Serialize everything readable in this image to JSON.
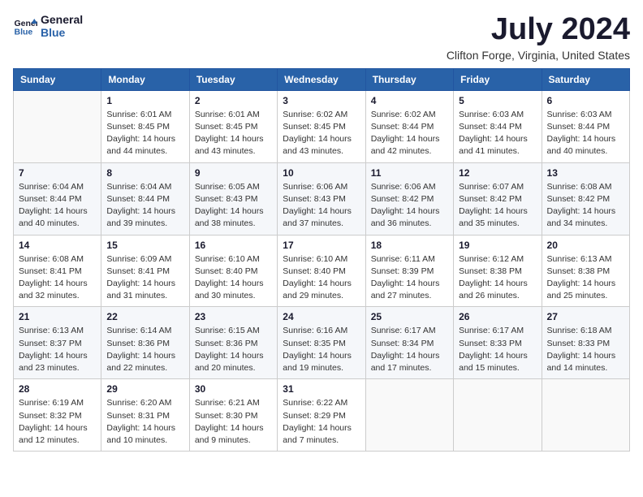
{
  "logo": {
    "text_general": "General",
    "text_blue": "Blue"
  },
  "title": "July 2024",
  "location": "Clifton Forge, Virginia, United States",
  "weekdays": [
    "Sunday",
    "Monday",
    "Tuesday",
    "Wednesday",
    "Thursday",
    "Friday",
    "Saturday"
  ],
  "weeks": [
    [
      {
        "day": "",
        "empty": true
      },
      {
        "day": "1",
        "sunrise": "6:01 AM",
        "sunset": "8:45 PM",
        "daylight": "14 hours and 44 minutes."
      },
      {
        "day": "2",
        "sunrise": "6:01 AM",
        "sunset": "8:45 PM",
        "daylight": "14 hours and 43 minutes."
      },
      {
        "day": "3",
        "sunrise": "6:02 AM",
        "sunset": "8:45 PM",
        "daylight": "14 hours and 43 minutes."
      },
      {
        "day": "4",
        "sunrise": "6:02 AM",
        "sunset": "8:44 PM",
        "daylight": "14 hours and 42 minutes."
      },
      {
        "day": "5",
        "sunrise": "6:03 AM",
        "sunset": "8:44 PM",
        "daylight": "14 hours and 41 minutes."
      },
      {
        "day": "6",
        "sunrise": "6:03 AM",
        "sunset": "8:44 PM",
        "daylight": "14 hours and 40 minutes."
      }
    ],
    [
      {
        "day": "7",
        "sunrise": "6:04 AM",
        "sunset": "8:44 PM",
        "daylight": "14 hours and 40 minutes."
      },
      {
        "day": "8",
        "sunrise": "6:04 AM",
        "sunset": "8:44 PM",
        "daylight": "14 hours and 39 minutes."
      },
      {
        "day": "9",
        "sunrise": "6:05 AM",
        "sunset": "8:43 PM",
        "daylight": "14 hours and 38 minutes."
      },
      {
        "day": "10",
        "sunrise": "6:06 AM",
        "sunset": "8:43 PM",
        "daylight": "14 hours and 37 minutes."
      },
      {
        "day": "11",
        "sunrise": "6:06 AM",
        "sunset": "8:42 PM",
        "daylight": "14 hours and 36 minutes."
      },
      {
        "day": "12",
        "sunrise": "6:07 AM",
        "sunset": "8:42 PM",
        "daylight": "14 hours and 35 minutes."
      },
      {
        "day": "13",
        "sunrise": "6:08 AM",
        "sunset": "8:42 PM",
        "daylight": "14 hours and 34 minutes."
      }
    ],
    [
      {
        "day": "14",
        "sunrise": "6:08 AM",
        "sunset": "8:41 PM",
        "daylight": "14 hours and 32 minutes."
      },
      {
        "day": "15",
        "sunrise": "6:09 AM",
        "sunset": "8:41 PM",
        "daylight": "14 hours and 31 minutes."
      },
      {
        "day": "16",
        "sunrise": "6:10 AM",
        "sunset": "8:40 PM",
        "daylight": "14 hours and 30 minutes."
      },
      {
        "day": "17",
        "sunrise": "6:10 AM",
        "sunset": "8:40 PM",
        "daylight": "14 hours and 29 minutes."
      },
      {
        "day": "18",
        "sunrise": "6:11 AM",
        "sunset": "8:39 PM",
        "daylight": "14 hours and 27 minutes."
      },
      {
        "day": "19",
        "sunrise": "6:12 AM",
        "sunset": "8:38 PM",
        "daylight": "14 hours and 26 minutes."
      },
      {
        "day": "20",
        "sunrise": "6:13 AM",
        "sunset": "8:38 PM",
        "daylight": "14 hours and 25 minutes."
      }
    ],
    [
      {
        "day": "21",
        "sunrise": "6:13 AM",
        "sunset": "8:37 PM",
        "daylight": "14 hours and 23 minutes."
      },
      {
        "day": "22",
        "sunrise": "6:14 AM",
        "sunset": "8:36 PM",
        "daylight": "14 hours and 22 minutes."
      },
      {
        "day": "23",
        "sunrise": "6:15 AM",
        "sunset": "8:36 PM",
        "daylight": "14 hours and 20 minutes."
      },
      {
        "day": "24",
        "sunrise": "6:16 AM",
        "sunset": "8:35 PM",
        "daylight": "14 hours and 19 minutes."
      },
      {
        "day": "25",
        "sunrise": "6:17 AM",
        "sunset": "8:34 PM",
        "daylight": "14 hours and 17 minutes."
      },
      {
        "day": "26",
        "sunrise": "6:17 AM",
        "sunset": "8:33 PM",
        "daylight": "14 hours and 15 minutes."
      },
      {
        "day": "27",
        "sunrise": "6:18 AM",
        "sunset": "8:33 PM",
        "daylight": "14 hours and 14 minutes."
      }
    ],
    [
      {
        "day": "28",
        "sunrise": "6:19 AM",
        "sunset": "8:32 PM",
        "daylight": "14 hours and 12 minutes."
      },
      {
        "day": "29",
        "sunrise": "6:20 AM",
        "sunset": "8:31 PM",
        "daylight": "14 hours and 10 minutes."
      },
      {
        "day": "30",
        "sunrise": "6:21 AM",
        "sunset": "8:30 PM",
        "daylight": "14 hours and 9 minutes."
      },
      {
        "day": "31",
        "sunrise": "6:22 AM",
        "sunset": "8:29 PM",
        "daylight": "14 hours and 7 minutes."
      },
      {
        "day": "",
        "empty": true
      },
      {
        "day": "",
        "empty": true
      },
      {
        "day": "",
        "empty": true
      }
    ]
  ],
  "labels": {
    "sunrise": "Sunrise:",
    "sunset": "Sunset:",
    "daylight": "Daylight:"
  }
}
